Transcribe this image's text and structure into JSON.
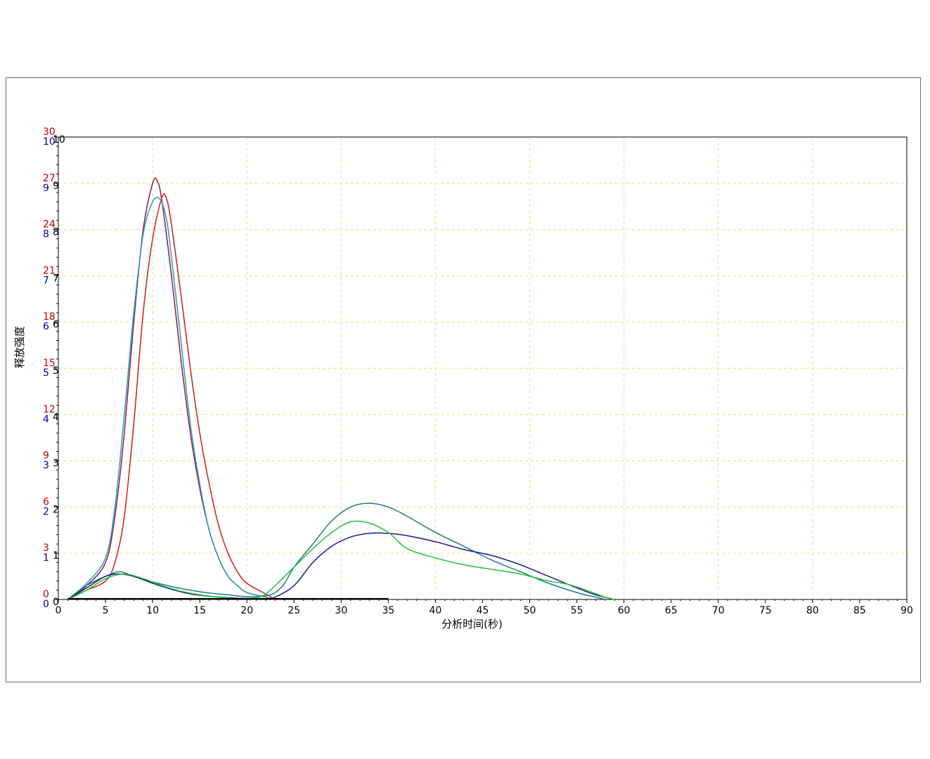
{
  "chart_data": {
    "type": "line",
    "title": "",
    "xlabel": "分析时间(秒)",
    "ylabel": "释放强度",
    "xlim": [
      0,
      90
    ],
    "x_ticks": [
      "0",
      "5",
      "10",
      "15",
      "20",
      "25",
      "30",
      "35",
      "40",
      "45",
      "50",
      "55",
      "60",
      "65",
      "70",
      "75",
      "80",
      "85",
      "90"
    ],
    "y_axes": [
      {
        "color": "#c00000",
        "ticks": [
          "0",
          "3",
          "6",
          "9",
          "12",
          "15",
          "18",
          "21",
          "24",
          "27",
          "30"
        ],
        "ylim": [
          0,
          30
        ]
      },
      {
        "color": "#00008b",
        "ticks": [
          "0",
          "1",
          "2",
          "3",
          "4",
          "5",
          "6",
          "7",
          "8",
          "9",
          "10"
        ],
        "ylim": [
          0,
          10
        ]
      },
      {
        "color": "#000000",
        "ticks": [
          "0",
          "1",
          "2",
          "3",
          "4",
          "5",
          "6",
          "7",
          "8",
          "9",
          "10"
        ],
        "ylim": [
          0,
          10
        ]
      }
    ],
    "grid": true,
    "grid_color": "#e6e6a0",
    "series": [
      {
        "color": "#8b1a4a",
        "axis": 2,
        "points": [
          [
            1,
            0
          ],
          [
            3,
            0.3
          ],
          [
            5,
            0.8
          ],
          [
            6,
            1.8
          ],
          [
            7,
            3.6
          ],
          [
            8,
            6.0
          ],
          [
            9,
            8.0
          ],
          [
            10,
            9.0
          ],
          [
            10.5,
            9.05
          ],
          [
            11,
            8.6
          ],
          [
            12,
            7.0
          ],
          [
            13,
            5.2
          ],
          [
            14,
            3.6
          ],
          [
            15,
            2.4
          ],
          [
            16,
            1.5
          ],
          [
            17,
            0.9
          ],
          [
            18,
            0.5
          ],
          [
            19,
            0.3
          ],
          [
            20,
            0.15
          ],
          [
            22,
            0.05
          ],
          [
            23,
            0
          ]
        ]
      },
      {
        "color": "#d01c1c",
        "axis": 2,
        "points": [
          [
            1,
            0
          ],
          [
            3,
            0.2
          ],
          [
            5,
            0.4
          ],
          [
            6,
            0.8
          ],
          [
            7,
            1.8
          ],
          [
            8,
            3.8
          ],
          [
            9,
            6.2
          ],
          [
            10,
            7.8
          ],
          [
            11,
            8.7
          ],
          [
            11.5,
            8.65
          ],
          [
            12,
            8.1
          ],
          [
            13,
            6.6
          ],
          [
            14,
            5.0
          ],
          [
            15,
            3.6
          ],
          [
            16,
            2.5
          ],
          [
            17,
            1.6
          ],
          [
            18,
            1.0
          ],
          [
            19,
            0.6
          ],
          [
            20,
            0.35
          ],
          [
            22,
            0.12
          ],
          [
            23,
            0
          ]
        ]
      },
      {
        "color": "#2a9fb0",
        "axis": 2,
        "points": [
          [
            1,
            0
          ],
          [
            3,
            0.35
          ],
          [
            5,
            0.9
          ],
          [
            6,
            2.0
          ],
          [
            7,
            4.0
          ],
          [
            8,
            6.2
          ],
          [
            9,
            7.9
          ],
          [
            10,
            8.6
          ],
          [
            10.8,
            8.65
          ],
          [
            11.5,
            8.2
          ],
          [
            12,
            7.4
          ],
          [
            13,
            5.6
          ],
          [
            14,
            3.8
          ],
          [
            15,
            2.5
          ],
          [
            16,
            1.5
          ],
          [
            17,
            0.9
          ],
          [
            18,
            0.5
          ],
          [
            19,
            0.3
          ],
          [
            20,
            0.15
          ],
          [
            22,
            0.05
          ],
          [
            23,
            0
          ]
        ]
      },
      {
        "color": "#1c7a8c",
        "axis": 2,
        "points": [
          [
            1,
            0
          ],
          [
            3,
            0.3
          ],
          [
            5,
            0.5
          ],
          [
            6.5,
            0.6
          ],
          [
            8,
            0.5
          ],
          [
            10,
            0.38
          ],
          [
            12,
            0.28
          ],
          [
            14,
            0.2
          ],
          [
            16,
            0.14
          ],
          [
            18,
            0.1
          ],
          [
            20,
            0.06
          ],
          [
            22,
            0.08
          ],
          [
            23,
            0.15
          ],
          [
            24,
            0.35
          ],
          [
            25,
            0.7
          ],
          [
            27,
            1.2
          ],
          [
            29,
            1.7
          ],
          [
            31,
            2.0
          ],
          [
            33,
            2.08
          ],
          [
            35,
            2.0
          ],
          [
            37,
            1.8
          ],
          [
            40,
            1.45
          ],
          [
            43,
            1.15
          ],
          [
            46,
            0.85
          ],
          [
            49,
            0.6
          ],
          [
            52,
            0.35
          ],
          [
            55,
            0.15
          ],
          [
            57,
            0.05
          ],
          [
            58,
            0
          ]
        ]
      },
      {
        "color": "#1a1a8c",
        "axis": 2,
        "points": [
          [
            1,
            0
          ],
          [
            3,
            0.25
          ],
          [
            5,
            0.5
          ],
          [
            6.5,
            0.55
          ],
          [
            8,
            0.5
          ],
          [
            10,
            0.35
          ],
          [
            12,
            0.22
          ],
          [
            14,
            0.12
          ],
          [
            16,
            0.07
          ],
          [
            18,
            0.04
          ],
          [
            20,
            0.02
          ],
          [
            22,
            0.02
          ],
          [
            23,
            0.05
          ],
          [
            25,
            0.3
          ],
          [
            27,
            0.8
          ],
          [
            29,
            1.15
          ],
          [
            31,
            1.35
          ],
          [
            33,
            1.43
          ],
          [
            35,
            1.43
          ],
          [
            37,
            1.38
          ],
          [
            40,
            1.25
          ],
          [
            43,
            1.08
          ],
          [
            46,
            0.95
          ],
          [
            49,
            0.75
          ],
          [
            52,
            0.5
          ],
          [
            55,
            0.25
          ],
          [
            57,
            0.1
          ],
          [
            59,
            0
          ]
        ]
      },
      {
        "color": "#22c22e",
        "axis": 2,
        "points": [
          [
            1,
            0
          ],
          [
            3,
            0.2
          ],
          [
            5,
            0.45
          ],
          [
            7,
            0.55
          ],
          [
            9,
            0.45
          ],
          [
            11,
            0.3
          ],
          [
            13,
            0.18
          ],
          [
            15,
            0.1
          ],
          [
            17,
            0.05
          ],
          [
            19,
            0.02
          ],
          [
            21,
            0.04
          ],
          [
            22,
            0.12
          ],
          [
            23,
            0.3
          ],
          [
            25,
            0.7
          ],
          [
            27,
            1.1
          ],
          [
            29,
            1.45
          ],
          [
            31,
            1.68
          ],
          [
            33,
            1.65
          ],
          [
            35,
            1.45
          ],
          [
            37,
            1.1
          ],
          [
            40,
            0.9
          ],
          [
            43,
            0.75
          ],
          [
            46,
            0.65
          ],
          [
            49,
            0.55
          ],
          [
            52,
            0.4
          ],
          [
            54,
            0.33
          ],
          [
            56,
            0.2
          ],
          [
            58,
            0.05
          ],
          [
            59,
            0
          ]
        ]
      }
    ]
  }
}
